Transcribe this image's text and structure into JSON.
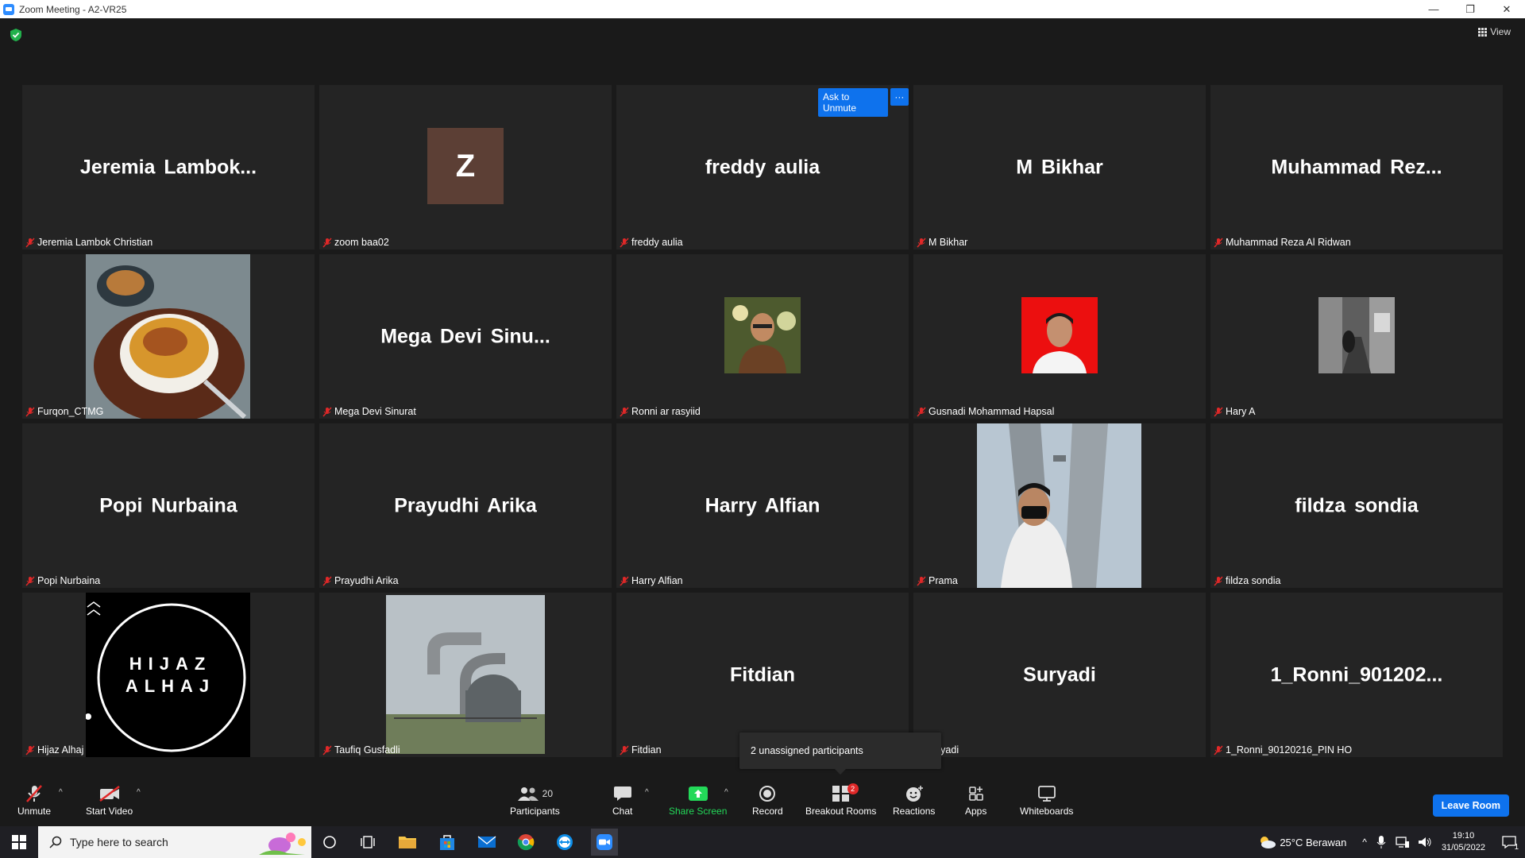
{
  "window": {
    "title": "Zoom Meeting - A2-VR25",
    "min": "—",
    "restore": "❐",
    "close": "✕"
  },
  "view": {
    "label": "View"
  },
  "tiles": [
    {
      "big": "Jeremia  Lambok...",
      "name": "Jeremia Lambok Christian"
    },
    {
      "avatar": "Z",
      "name": "zoom baa02"
    },
    {
      "big": "freddy aulia",
      "name": "freddy aulia"
    },
    {
      "big": "M Bikhar",
      "name": "M Bikhar"
    },
    {
      "big": "Muhammad  Rez...",
      "name": "Muhammad Reza Al Ridwan"
    },
    {
      "name": "Furqon_CTMG"
    },
    {
      "big": "Mega  Devi  Sinu...",
      "name": "Mega Devi Sinurat"
    },
    {
      "name": "Ronni ar rasyiid"
    },
    {
      "name": "Gusnadi Mohammad Hapsal"
    },
    {
      "name": "Hary A"
    },
    {
      "big": "Popi Nurbaina",
      "name": "Popi Nurbaina"
    },
    {
      "big": "Prayudhi Arika",
      "name": "Prayudhi Arika"
    },
    {
      "big": "Harry Alfian",
      "name": "Harry Alfian"
    },
    {
      "name": "Prama"
    },
    {
      "big": "fildza sondia",
      "name": "fildza sondia"
    },
    {
      "name": "Hijaz Alhaj",
      "logo_line1": "HIJAZ",
      "logo_line2": "ALHAJ"
    },
    {
      "name": "Taufiq Gusfadli"
    },
    {
      "big": "Fitdian",
      "name": "Fitdian"
    },
    {
      "big": "Suryadi",
      "name": "ryadi"
    },
    {
      "big": "1_Ronni_901202...",
      "name": "1_Ronni_90120216_PIN HO"
    }
  ],
  "ask_unmute": {
    "label": "Ask to Unmute",
    "more": "···"
  },
  "unassigned_popup": "2 unassigned participants",
  "toolbar": {
    "unmute": "Unmute",
    "start_video": "Start Video",
    "participants": "Participants",
    "participants_count": "20",
    "chat": "Chat",
    "share_screen": "Share Screen",
    "record": "Record",
    "breakout_rooms": "Breakout Rooms",
    "breakout_badge": "2",
    "reactions": "Reactions",
    "apps": "Apps",
    "whiteboards": "Whiteboards",
    "leave": "Leave Room",
    "caret": "^"
  },
  "taskbar": {
    "search_placeholder": "Type here to search",
    "weather": "25°C  Berawan",
    "time": "19:10",
    "date": "31/05/2022",
    "notif_count": "1"
  },
  "colors": {
    "accent": "#0e72ed",
    "share_green": "#23d959",
    "mute_red": "#e02828"
  }
}
